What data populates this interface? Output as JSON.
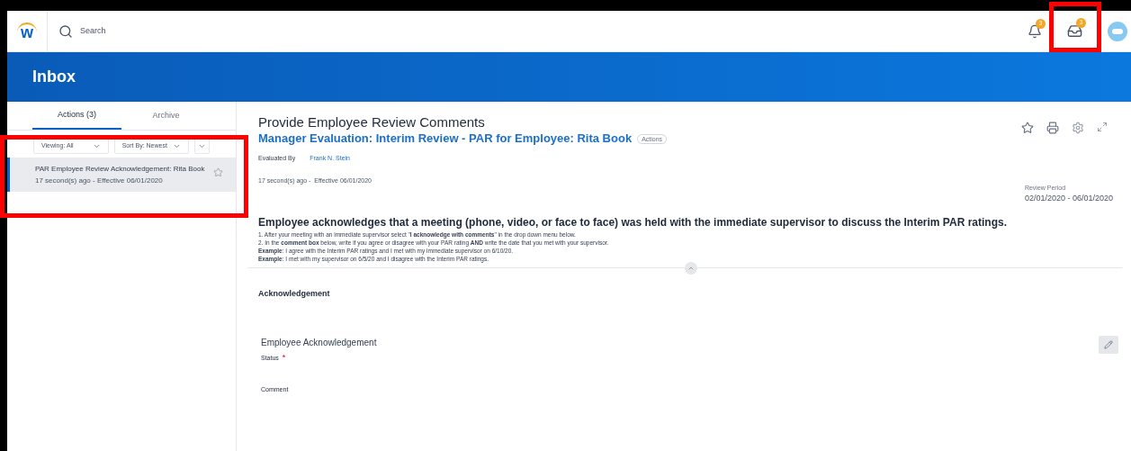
{
  "topbar": {
    "logo": "w",
    "search": {
      "placeholder": "Search"
    },
    "notifications_badge": "3",
    "inbox_badge": "3"
  },
  "header": {
    "title": "Inbox"
  },
  "sidebar": {
    "tabs": [
      {
        "label": "Actions (3)",
        "selected": true
      },
      {
        "label": "Archive",
        "selected": false
      }
    ],
    "filters": [
      {
        "label": "Viewing: All"
      },
      {
        "label": "Sort By: Newest"
      }
    ],
    "items": [
      {
        "title": "PAR Employee Review Acknowledgement: Rita Book",
        "subtitle": "17 second(s) ago - Effective 06/01/2020",
        "selected": true
      }
    ]
  },
  "task": {
    "title": "Provide Employee Review Comments",
    "subtitle": "Manager Evaluation: Interim Review - PAR for Employee: Rita Book",
    "actions_label": "Actions",
    "evaluated_by_label": "Evaluated By",
    "evaluated_by": "Frank N. Stein",
    "timestamp": "17 second(s) ago -  Effective 06/01/2020",
    "review_period_label": "Review Period",
    "review_period": "02/01/2020 - 06/01/2020"
  },
  "instructions": {
    "heading": "Employee acknowledges that a meeting (phone, video, or face to face) was held with the immediate supervisor to discuss the Interim PAR ratings.",
    "lines": [
      "1. After your meeting with an immediate supervisor select \"**I acknowledge with comments**\" in the drop down menu below.",
      "2. In the **comment box** below, write if you agree or disagree with your PAR rating **AND** write the date that you met with your supervisor.",
      "**Example**: I agree with the Interim PAR ratings and I met with my immediate supervisor on 6/10/20.",
      "**Example**: I met with my supervisor on 6/5/20 and I disagree with the Interim PAR ratings."
    ]
  },
  "acknowledgement": {
    "section_title": "Acknowledgement",
    "field_group": "Employee Acknowledgement",
    "fields": [
      {
        "label": "Status",
        "required_mark": "*"
      },
      {
        "label": "Comment"
      }
    ]
  }
}
